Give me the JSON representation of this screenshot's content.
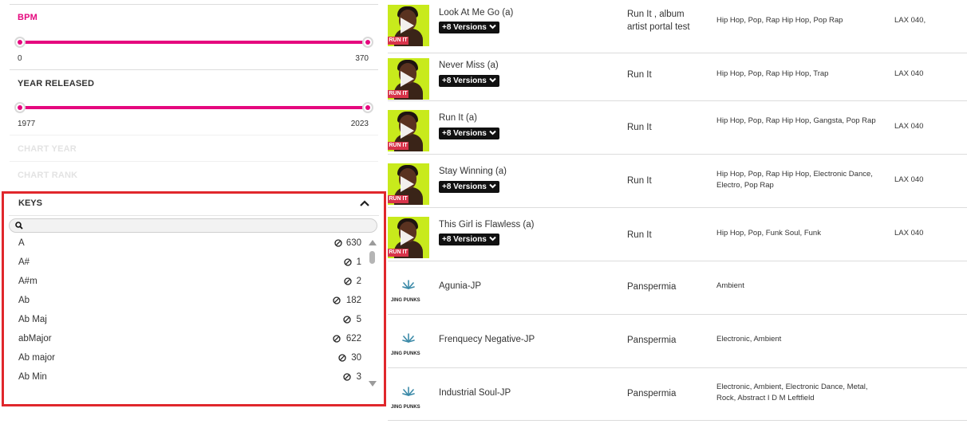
{
  "filters": {
    "bpm": {
      "title": "BPM",
      "min": "0",
      "max": "370"
    },
    "year_released": {
      "title": "YEAR RELEASED",
      "min": "1977",
      "max": "2023"
    },
    "chart_year": {
      "title": "CHART YEAR"
    },
    "chart_rank": {
      "title": "CHART RANK"
    },
    "keys": {
      "title": "KEYS",
      "search_placeholder": "",
      "items": [
        {
          "label": "A",
          "count": "630"
        },
        {
          "label": "A#",
          "count": "1"
        },
        {
          "label": "A#m",
          "count": "2"
        },
        {
          "label": "Ab",
          "count": "182"
        },
        {
          "label": "Ab Maj",
          "count": "5"
        },
        {
          "label": "abMajor",
          "count": "622"
        },
        {
          "label": "Ab major",
          "count": "30"
        },
        {
          "label": "Ab Min",
          "count": "3"
        }
      ]
    }
  },
  "tracks": [
    {
      "title": "Look At Me Go (a)",
      "versions": "+8 Versions",
      "artist": "Run It , album artist portal test",
      "genres": "Hip Hop,  Pop,  Rap Hip Hop,  Pop Rap",
      "label": "LAX 040,",
      "art": "run-it-cover"
    },
    {
      "title": "Never Miss (a)",
      "versions": "+8 Versions",
      "artist": "Run It",
      "genres": "Hip Hop,  Pop,  Rap Hip Hop,  Trap",
      "label": "LAX 040",
      "art": "run-it-cover"
    },
    {
      "title": "Run It (a)",
      "versions": "+8 Versions",
      "artist": "Run It",
      "genres": "Hip Hop,  Pop,  Rap Hip Hop,  Gangsta, Pop Rap",
      "label": "LAX 040",
      "art": "run-it-cover"
    },
    {
      "title": "Stay Winning (a)",
      "versions": "+8 Versions",
      "artist": "Run It",
      "genres": "Hip Hop,  Pop,  Rap Hip Hop, Electronic Dance,  Electro,  Pop Rap",
      "label": "LAX 040",
      "art": "run-it-cover"
    },
    {
      "title": "This Girl is Flawless (a)",
      "versions": "+8 Versions",
      "artist": "Run It",
      "genres": "Hip Hop,  Pop,  Funk Soul,  Funk",
      "label": "LAX 040",
      "art": "run-it-cover"
    },
    {
      "title": "Agunia-JP",
      "artist": "Panspermia",
      "genres": "Ambient",
      "label": "",
      "art": "jing-punks-logo"
    },
    {
      "title": "Frenquecy Negative-JP",
      "artist": "Panspermia",
      "genres": "Electronic,  Ambient",
      "label": "",
      "art": "jing-punks-logo"
    },
    {
      "title": "Industrial Soul-JP",
      "artist": "Panspermia",
      "genres": "Electronic,  Ambient,  Electronic Dance, Metal,  Rock,  Abstract I D M Leftfield",
      "label": "",
      "art": "jing-punks-logo"
    }
  ],
  "art_text": {
    "run_it_stamp": "RUN IT",
    "pans_logo": "JING PUNKS"
  },
  "colors": {
    "accent": "#e5087e",
    "highlight_border": "#e0272c",
    "cover_bg": "#c8ea1c"
  }
}
